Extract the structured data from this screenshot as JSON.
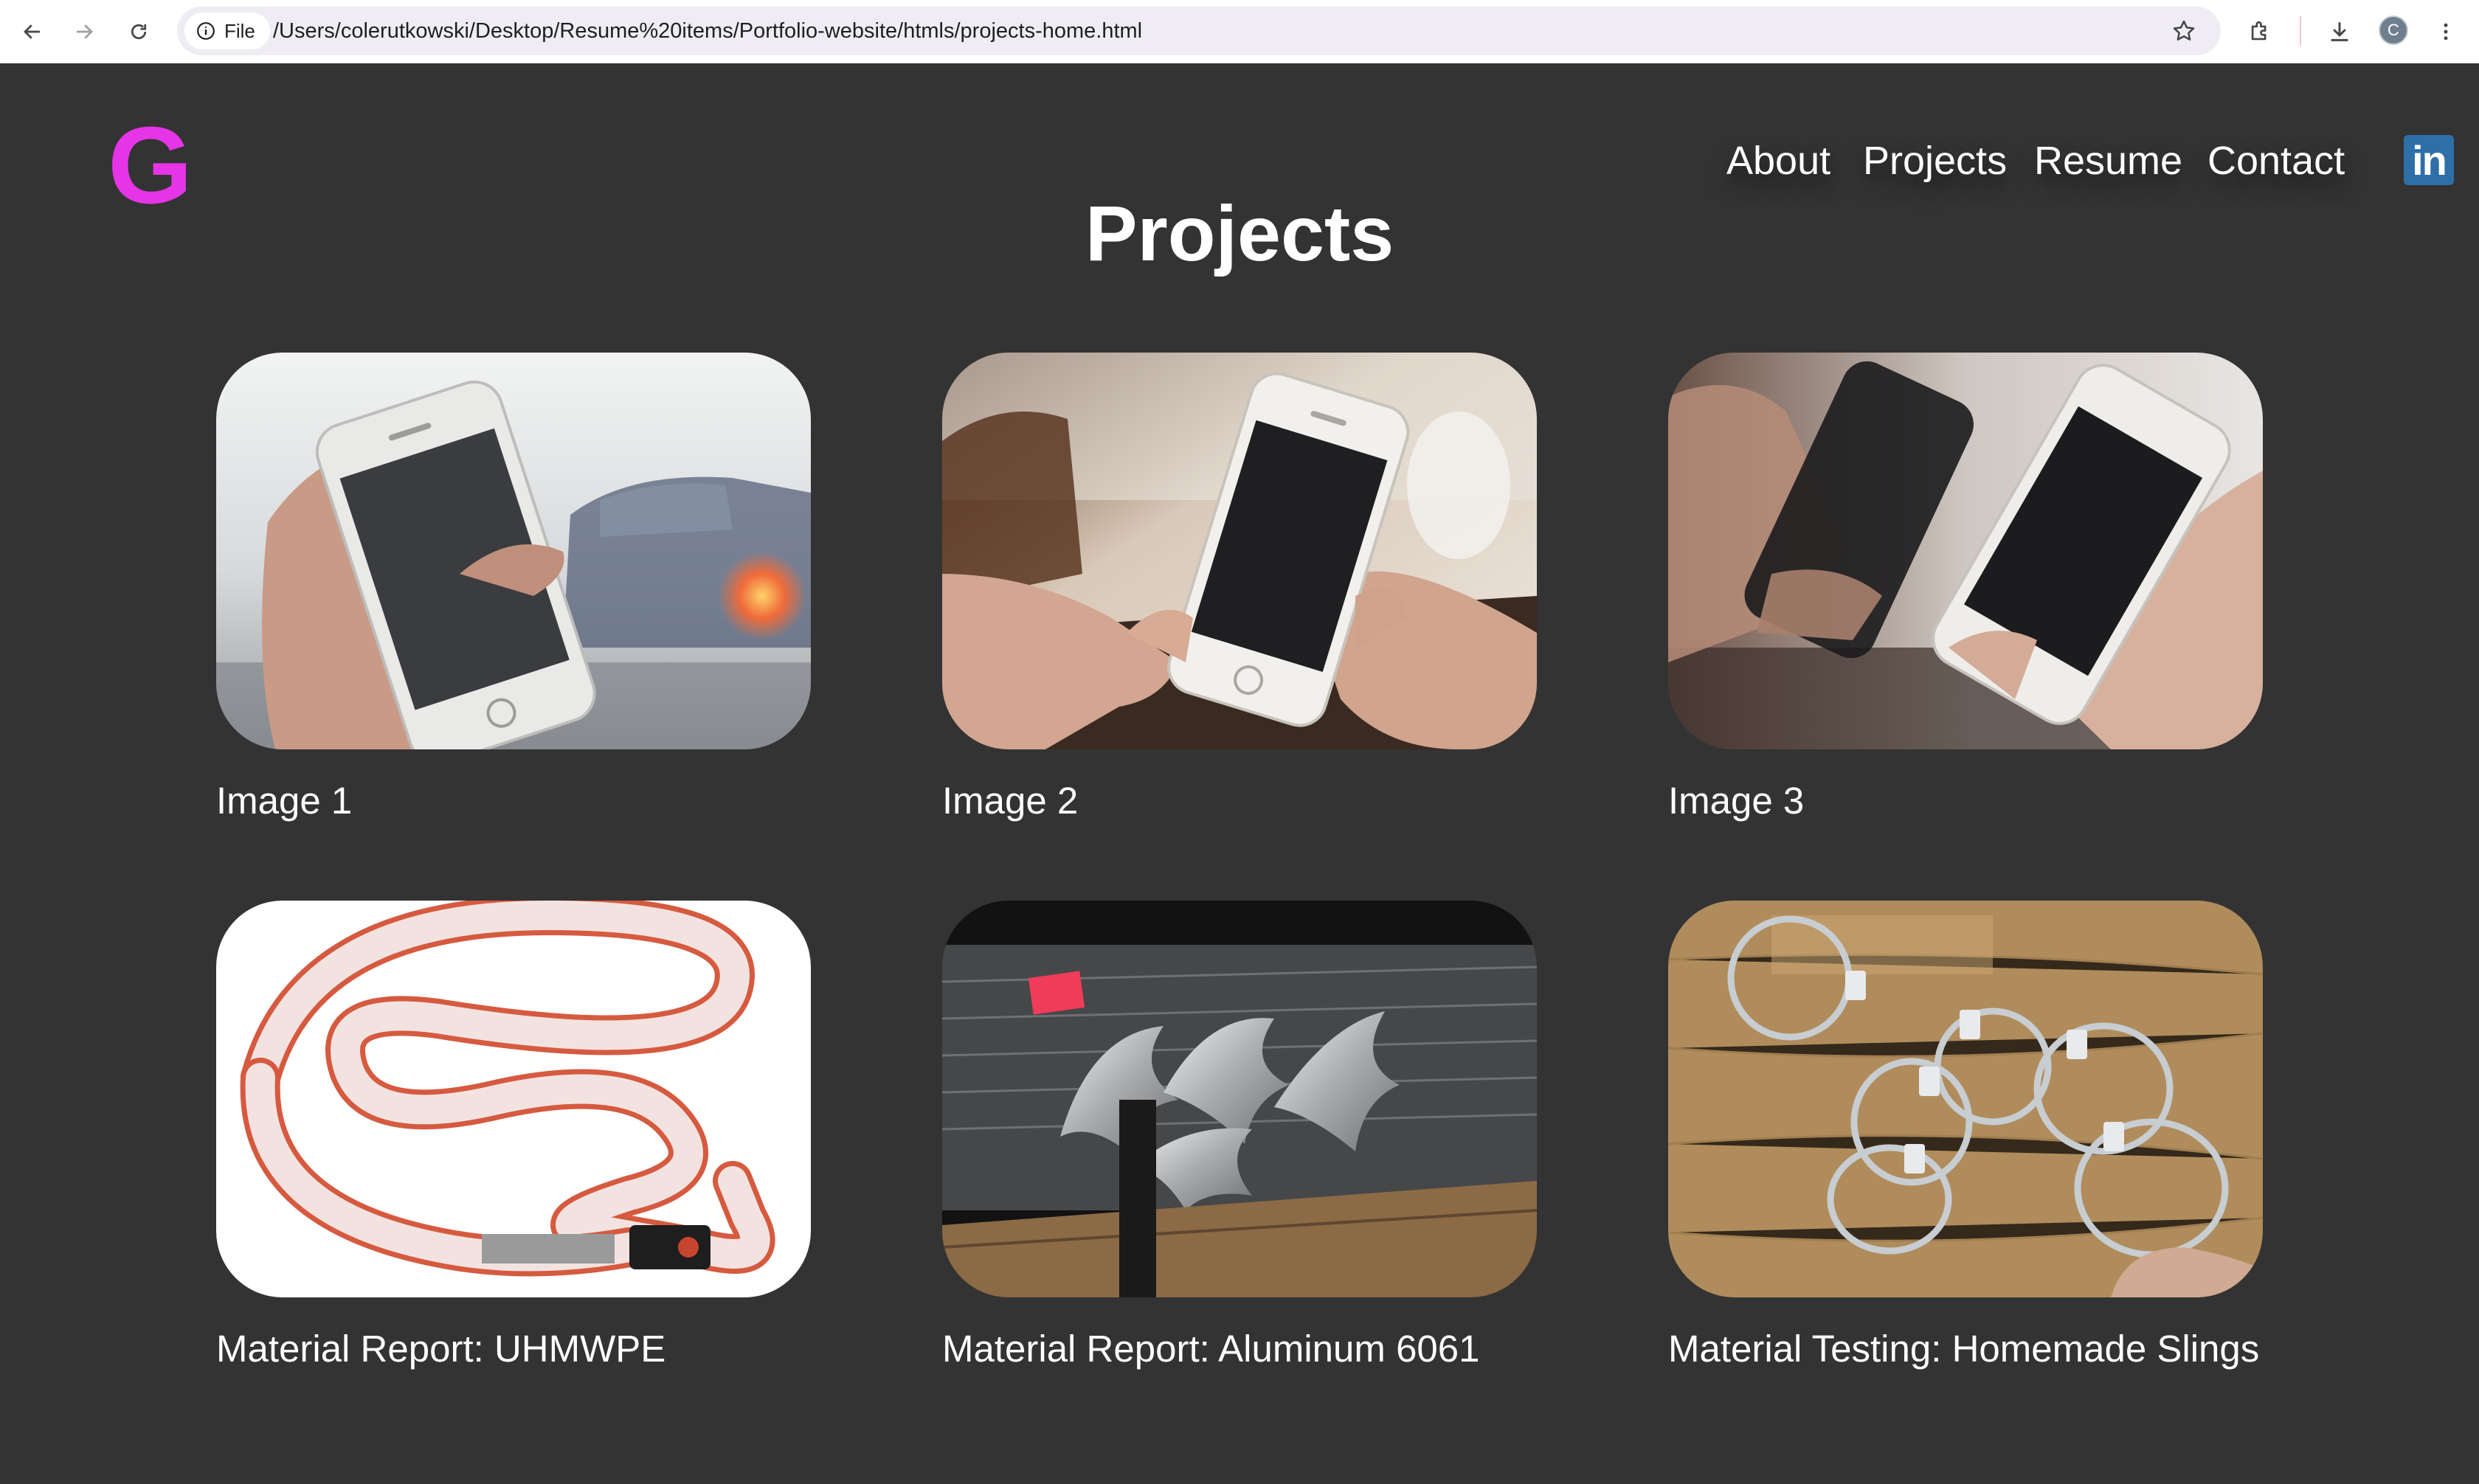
{
  "browser": {
    "scheme_chip": "File",
    "url": "/Users/colerutkowski/Desktop/Resume%20items/Portfolio-website/htmls/projects-home.html",
    "profile_initial": "C"
  },
  "header": {
    "logo": "G",
    "nav": [
      "About",
      "Projects",
      "Resume",
      "Contact"
    ],
    "linkedin_label": "in"
  },
  "page_title": "Projects",
  "projects": [
    {
      "caption": "Image 1"
    },
    {
      "caption": "Image 2"
    },
    {
      "caption": "Image 3"
    },
    {
      "caption": "Material Report: UHMWPE"
    },
    {
      "caption": "Material Report: Aluminum 6061"
    },
    {
      "caption": "Material Testing: Homemade Slings"
    }
  ],
  "colors": {
    "background": "#333333",
    "logo": "#e535e6",
    "linkedin": "#2f6fa8"
  }
}
